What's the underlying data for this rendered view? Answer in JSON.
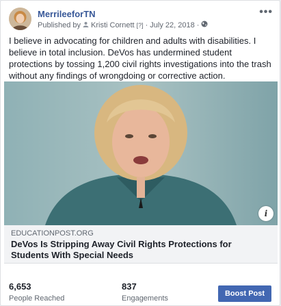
{
  "post": {
    "page_name": "MerrileeforTN",
    "published_by_prefix": "Published by",
    "publisher": "Kristi Cornett",
    "publisher_tag": "[?]",
    "separator": "·",
    "date": "July 22, 2018",
    "more_label": "•••",
    "text": "I believe in advocating for children and adults with disabilities. I believe in total inclusion. DeVos has undermined student protections by tossing 1,200 civil rights investigations into the trash without any findings of wrongdoing or corrective action."
  },
  "link": {
    "domain": "EDUCATIONPOST.ORG",
    "headline": "DeVos Is Stripping Away Civil Rights Protections for Students With Special Needs",
    "info_label": "i"
  },
  "stats": {
    "reached_value": "6,653",
    "reached_label": "People Reached",
    "engagements_value": "837",
    "engagements_label": "Engagements",
    "boost_label": "Boost Post"
  },
  "colors": {
    "link_blue": "#385898",
    "button_blue": "#4267b2"
  }
}
